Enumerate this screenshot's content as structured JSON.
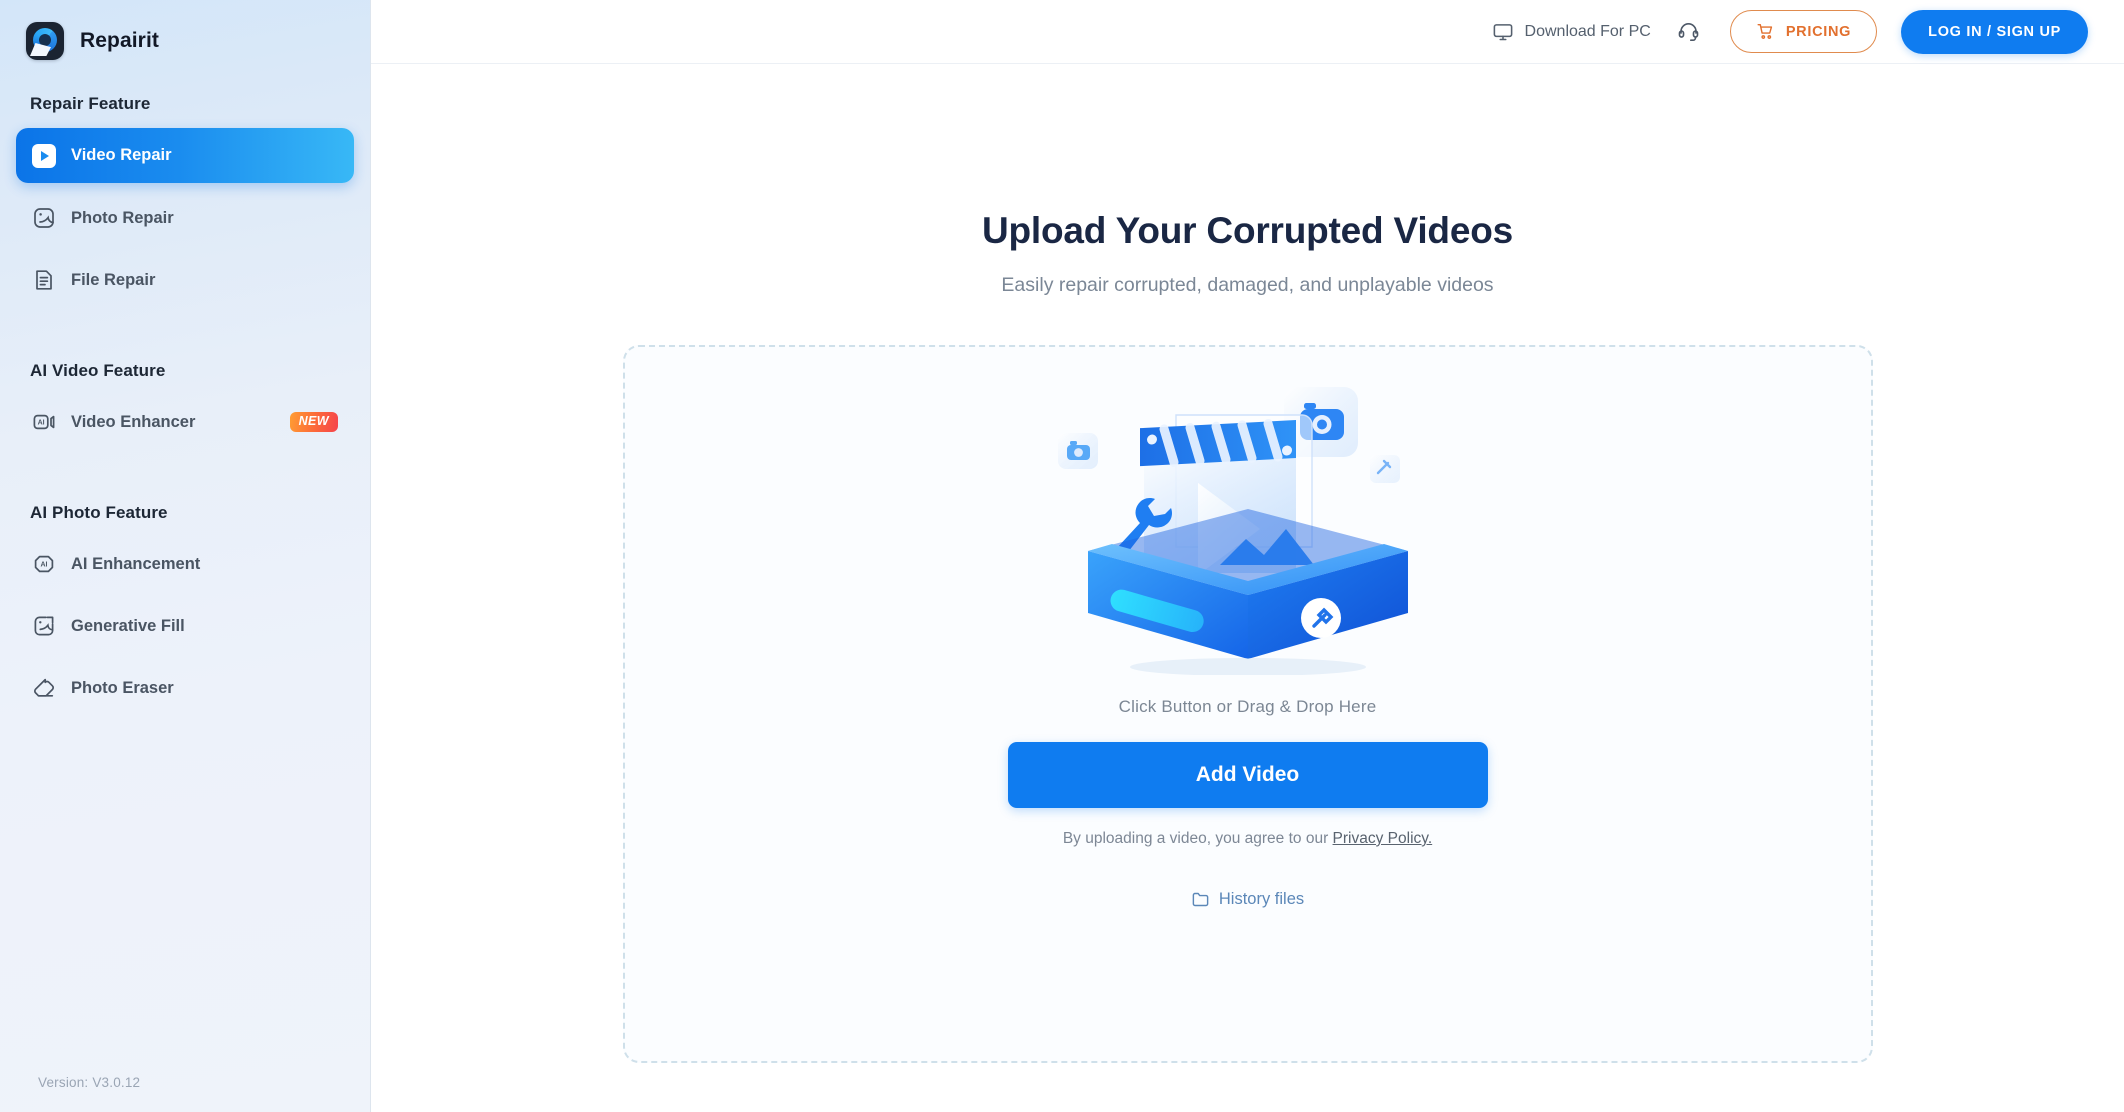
{
  "brand": {
    "name": "Repairit",
    "logo_icon": "repairit-logo-icon"
  },
  "sidebar": {
    "sections": [
      {
        "label": "Repair Feature"
      },
      {
        "label": "AI Video Feature"
      },
      {
        "label": "AI Photo Feature"
      }
    ],
    "items": [
      {
        "label": "Video Repair",
        "icon": "video-play-icon",
        "active": true,
        "badge": ""
      },
      {
        "label": "Photo Repair",
        "icon": "image-icon",
        "active": false,
        "badge": ""
      },
      {
        "label": "File Repair",
        "icon": "document-icon",
        "active": false,
        "badge": ""
      },
      {
        "label": "Video Enhancer",
        "icon": "ai-video-icon",
        "active": false,
        "badge": "NEW"
      },
      {
        "label": "AI Enhancement",
        "icon": "ai-sparkle-icon",
        "active": false,
        "badge": ""
      },
      {
        "label": "Generative Fill",
        "icon": "generative-fill-icon",
        "active": false,
        "badge": ""
      },
      {
        "label": "Photo Eraser",
        "icon": "eraser-icon",
        "active": false,
        "badge": ""
      }
    ],
    "version": "Version: V3.0.12"
  },
  "topbar": {
    "download_label": "Download For PC",
    "download_icon": "monitor-icon",
    "support_icon": "headset-icon",
    "pricing_label": "PRICING",
    "pricing_icon": "cart-icon",
    "login_label": "LOG IN / SIGN UP"
  },
  "main": {
    "title": "Upload Your Corrupted Videos",
    "subtitle": "Easily repair corrupted, damaged, and unplayable videos",
    "illustration_name": "video-repair-toolbox-illustration",
    "drop_hint": "Click Button or Drag & Drop Here",
    "add_button": "Add Video",
    "agree_prefix": "By uploading a video, you agree to our ",
    "privacy_link": "Privacy Policy.",
    "history_label": "History files",
    "history_icon": "folder-icon"
  },
  "colors": {
    "accent_blue": "#0f7cf0",
    "active_gradient_start": "#0b74e8",
    "active_gradient_end": "#38b8f6",
    "pricing_orange": "#e2702e",
    "badge_new_start": "#ff9d33",
    "badge_new_end": "#f5434c",
    "title_navy": "#1a2744",
    "dashed_border": "#cfe0ea"
  }
}
